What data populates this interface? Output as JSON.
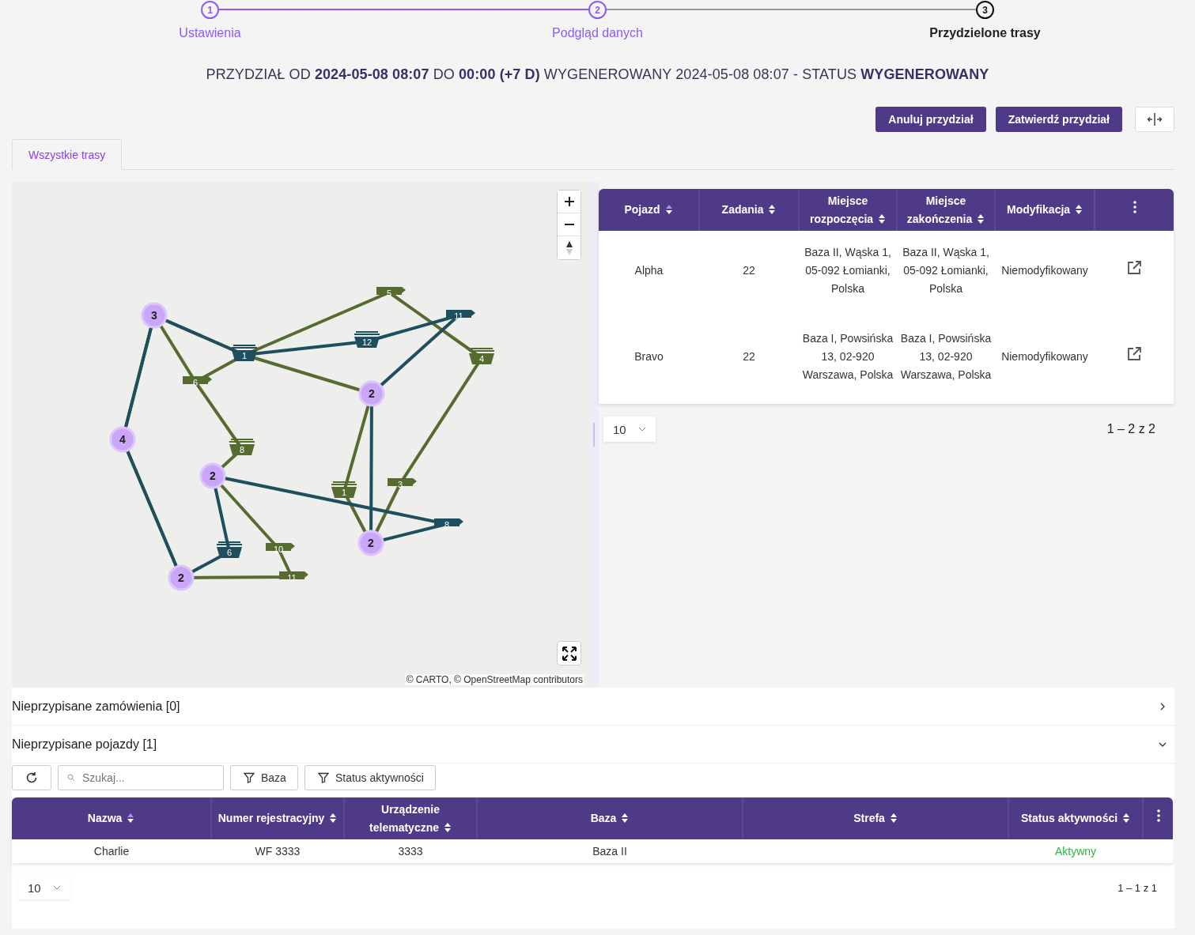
{
  "stepper": [
    {
      "number": "1",
      "label": "Ustawienia",
      "completed": true,
      "selected": false
    },
    {
      "number": "2",
      "label": "Podgląd danych",
      "completed": true,
      "selected": false
    },
    {
      "number": "3",
      "label": "Przydzielone trasy",
      "completed": false,
      "selected": true
    }
  ],
  "summary": "PRZYDZIAŁ OD **2024-05-08 08:07** DO **00:00 (+7 D)** WYGENEROWANY 2024-05-08 08:07 - STATUS **WYGENEROWANY**",
  "actions": [
    "Anuluj przydział",
    "Zatwierdź przydział"
  ],
  "tabs": [
    {
      "label": "Wszystkie trasy",
      "selected": true
    }
  ],
  "map": {
    "routes": [
      {
        "color": "#556b2f"
      },
      {
        "color": "#1f4e5f"
      }
    ],
    "depots": [
      {
        "label": "3"
      },
      {
        "label": "4"
      },
      {
        "label": "2"
      },
      {
        "label": "2"
      },
      {
        "label": "2"
      },
      {
        "label": "2"
      }
    ],
    "stops": [
      {
        "label": "1",
        "kind": "bin",
        "color": "#1f4e5f"
      },
      {
        "label": "6",
        "kind": "flag",
        "color": "#556b2f"
      },
      {
        "label": "8",
        "kind": "bin",
        "color": "#556b2f"
      },
      {
        "label": "5",
        "kind": "flag",
        "color": "#556b2f"
      },
      {
        "label": "12",
        "kind": "bin",
        "color": "#1f4e5f"
      },
      {
        "label": "11",
        "kind": "flag",
        "color": "#1f4e5f"
      },
      {
        "label": "4",
        "kind": "bin",
        "color": "#556b2f"
      },
      {
        "label": "1",
        "kind": "bin",
        "color": "#556b2f"
      },
      {
        "label": "3",
        "kind": "flag",
        "color": "#556b2f"
      },
      {
        "label": "8",
        "kind": "flag",
        "color": "#1f4e5f"
      },
      {
        "label": "6",
        "kind": "bin",
        "color": "#1f4e5f"
      },
      {
        "label": "10",
        "kind": "flag",
        "color": "#556b2f"
      },
      {
        "label": "11",
        "kind": "flag",
        "color": "#556b2f"
      }
    ],
    "attribution": "© CARTO, © OpenStreetMap contributors"
  },
  "routes_table": {
    "columns": [
      {
        "label": "Pojazd",
        "sorted": true
      },
      {
        "label": "Zadania",
        "sorted": false
      },
      {
        "label": "Miejsce rozpoczęcia",
        "sorted": false
      },
      {
        "label": "Miejsce zakończenia",
        "sorted": false
      },
      {
        "label": "Modyfikacja",
        "sorted": false
      }
    ],
    "rows": [
      {
        "vehicle": "Alpha",
        "tasks": "22",
        "start": "Baza II, Wąska 1, 05-092 Łomianki, Polska",
        "end": "Baza II, Wąska 1, 05-092 Łomianki, Polska",
        "modification": "Niemodyfikowany"
      },
      {
        "vehicle": "Bravo",
        "tasks": "22",
        "start": "Baza I, Powsińska 13, 02-920 Warszawa, Polska",
        "end": "Baza I, Powsińska 13, 02-920 Warszawa, Polska",
        "modification": "Niemodyfikowany"
      }
    ],
    "page_size": "10",
    "range": "1 – 2 z 2"
  },
  "sections": [
    {
      "title": "Nieprzypisane zamówienia [0]",
      "expanded": false
    },
    {
      "title": "Nieprzypisane pojazdy [1]",
      "expanded": true
    }
  ],
  "vehicles": {
    "search": {
      "placeholder": "Szukaj..."
    },
    "filters": [
      "Baza",
      "Status aktywności"
    ],
    "columns": [
      {
        "label": "Nazwa",
        "sorted": true
      },
      {
        "label": "Numer rejestracyjny",
        "sorted": false
      },
      {
        "label": "Urządzenie telematyczne",
        "sorted": false
      },
      {
        "label": "Baza",
        "sorted": false
      },
      {
        "label": "Strefa",
        "sorted": false
      },
      {
        "label": "Status aktywności",
        "sorted": false
      }
    ],
    "rows": [
      {
        "name": "Charlie",
        "plate": "WF 3333",
        "device": "3333",
        "base": "Baza II",
        "status": {
          "label": "Aktywny",
          "active": true
        }
      }
    ],
    "page_size": "10",
    "range": "1 – 1 z 1"
  }
}
